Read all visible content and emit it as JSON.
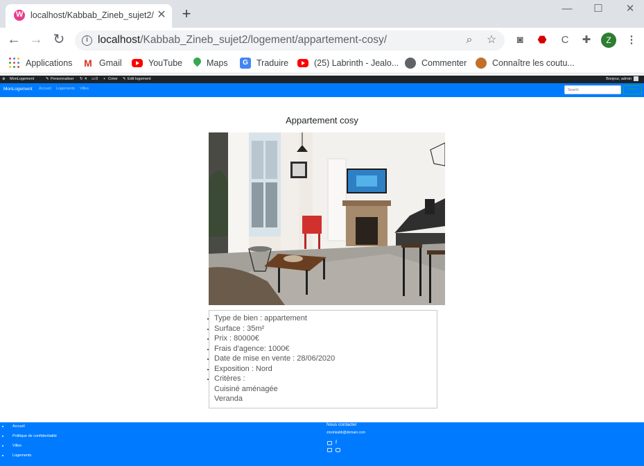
{
  "browser": {
    "tab_title": "localhost/Kabbab_Zineb_sujet2/lo",
    "url_host": "localhost",
    "url_path": "/Kabbab_Zineb_sujet2/logement/appartement-cosy/",
    "avatar_letter": "Z",
    "bookmarks": [
      {
        "label": "Applications",
        "icon": "apps-grid-icon"
      },
      {
        "label": "Gmail",
        "icon": "gmail-icon"
      },
      {
        "label": "YouTube",
        "icon": "youtube-icon"
      },
      {
        "label": "Maps",
        "icon": "maps-pin-icon"
      },
      {
        "label": "Traduire",
        "icon": "translate-icon"
      },
      {
        "label": "(25) Labrinth - Jealo...",
        "icon": "youtube-icon"
      },
      {
        "label": "Commenter",
        "icon": "globe-icon"
      },
      {
        "label": "Connaître les coutu...",
        "icon": "cookie-icon"
      }
    ]
  },
  "adminbar": {
    "site": "MonLogement",
    "customize": "Personnaliser",
    "updates": "4",
    "comments": "0",
    "new": "Créer",
    "edit": "Edit logement",
    "user": "Bonjour, admin"
  },
  "navbar": {
    "brand": "MonLogement",
    "links": [
      "Accueil",
      "Logements",
      "Villes"
    ],
    "search_placeholder": "Search",
    "search_button": "Search"
  },
  "main": {
    "title": "Appartement cosy",
    "details": [
      "Type de bien : appartement",
      "Surface : 35m²",
      "Prix : 80000€",
      "Frais d'agence: 1000€",
      "Date de mise en vente : 28/06/2020",
      "Exposition : Nord",
      "Critères :",
      "Cuisiné aménagée",
      "Veranda"
    ]
  },
  "footer": {
    "links": [
      "Accueil",
      "Politique de confidentialité",
      "Villes",
      "Logements"
    ],
    "contact_title": "Nous contacter",
    "email": "zinzinkabb@domain.com"
  },
  "colors": {
    "primary": "#007bff",
    "adminbar": "#1d2327",
    "tabstrip": "#dee1e6"
  }
}
